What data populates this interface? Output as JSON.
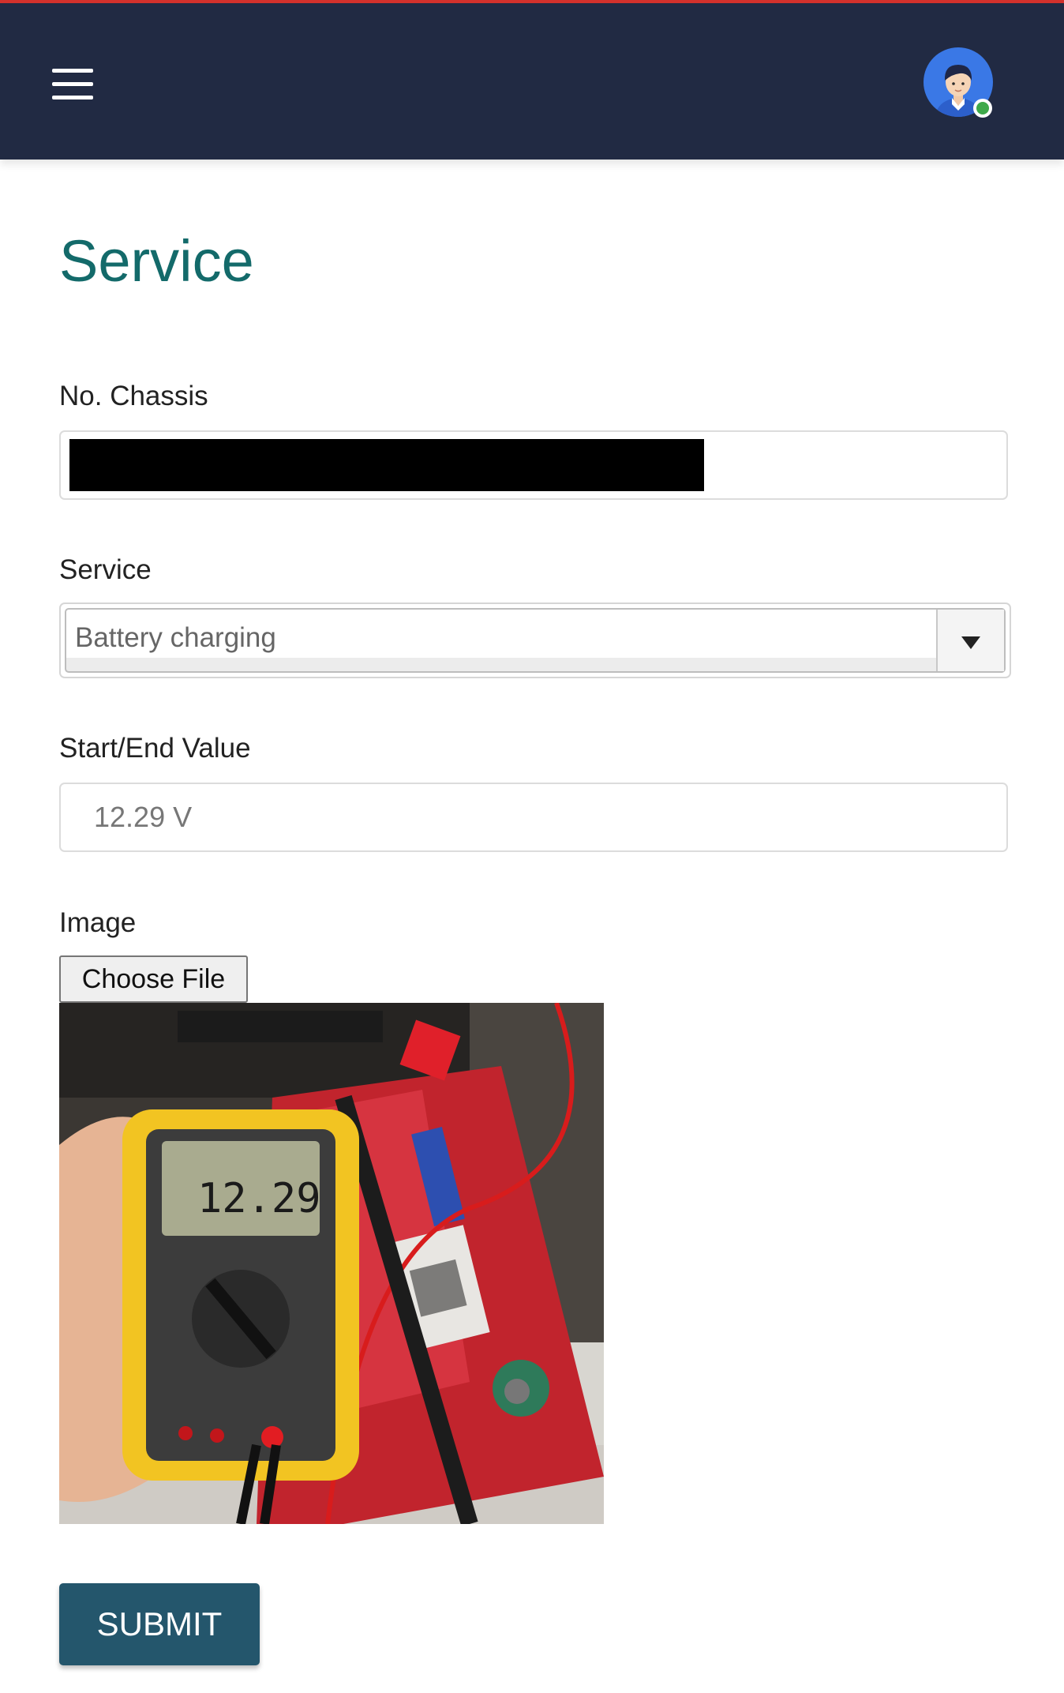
{
  "header": {
    "menu_icon": "hamburger-menu-icon",
    "avatar_icon": "user-avatar-icon",
    "online_status_color": "#3ea94a",
    "bar_color": "#212a43",
    "accent_color": "#d3312c"
  },
  "page": {
    "title": "Service",
    "title_color": "#136a6a"
  },
  "form": {
    "chassis": {
      "label": "No. Chassis",
      "value": ""
    },
    "service": {
      "label": "Service",
      "selected": "Battery charging",
      "icon": "caret-down-icon"
    },
    "start_end": {
      "label": "Start/End Value",
      "value": "12.29 V"
    },
    "image": {
      "label": "Image",
      "choose_label": "Choose File",
      "preview_display_text": "12.29"
    },
    "submit_label": "SUBMIT",
    "submit_color": "#24566c"
  }
}
